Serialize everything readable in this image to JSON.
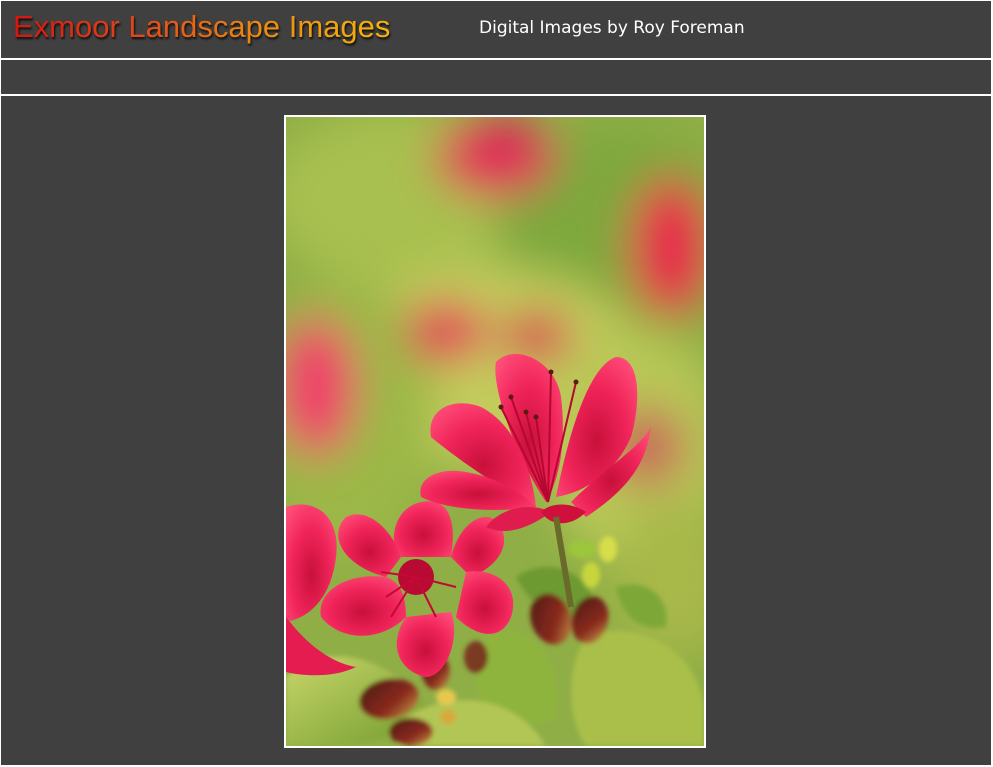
{
  "header": {
    "site_title": "Exmoor Landscape Images",
    "subtitle": "Digital Images by Roy Foreman"
  },
  "colors": {
    "background": "#404040",
    "rule": "#ffffff",
    "title_gradient": [
      "#d4160e",
      "#ec8a10",
      "#f6b40c"
    ],
    "subtitle_text": "#ffffff"
  },
  "photo": {
    "subject": "red azalea flowers"
  }
}
